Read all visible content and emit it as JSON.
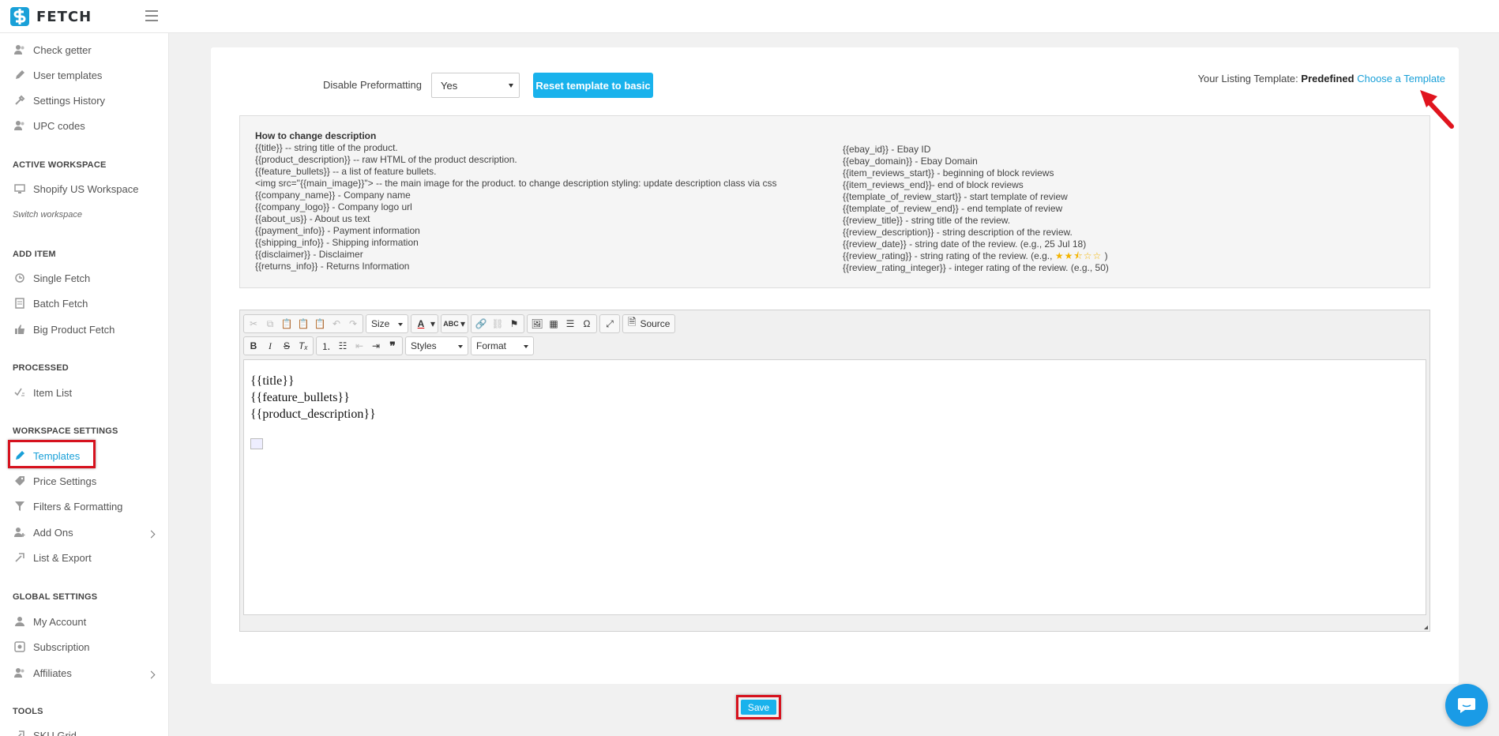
{
  "header": {
    "logo_text": "FETCH"
  },
  "sidebar": {
    "items_top": [
      {
        "label": "Check getter",
        "icon": "users-icon"
      },
      {
        "label": "User templates",
        "icon": "pencil-icon"
      },
      {
        "label": "Settings History",
        "icon": "tools-icon"
      },
      {
        "label": "UPC codes",
        "icon": "users-icon"
      }
    ],
    "active_workspace_heading": "ACTIVE WORKSPACE",
    "workspace": {
      "label": "Shopify US Workspace",
      "icon": "monitor-icon"
    },
    "switch_workspace": "Switch workspace",
    "add_item_heading": "ADD ITEM",
    "add_items": [
      {
        "label": "Single Fetch",
        "icon": "fetch-icon"
      },
      {
        "label": "Batch Fetch",
        "icon": "list-icon"
      },
      {
        "label": "Big Product Fetch",
        "icon": "thumb-icon"
      }
    ],
    "processed_heading": "PROCESSED",
    "processed_items": [
      {
        "label": "Item List",
        "icon": "check-list-icon"
      }
    ],
    "workspace_settings_heading": "WORKSPACE SETTINGS",
    "workspace_settings_items": [
      {
        "label": "Templates",
        "icon": "pencil-icon",
        "active": true
      },
      {
        "label": "Price Settings",
        "icon": "tag-icon"
      },
      {
        "label": "Filters & Formatting",
        "icon": "filter-icon"
      },
      {
        "label": "Add Ons",
        "icon": "user-plus-icon"
      },
      {
        "label": "List & Export",
        "icon": "export-icon"
      }
    ],
    "global_settings_heading": "GLOBAL SETTINGS",
    "global_settings_items": [
      {
        "label": "My Account",
        "icon": "user-icon"
      },
      {
        "label": "Subscription",
        "icon": "subscription-icon"
      },
      {
        "label": "Affiliates",
        "icon": "users-icon"
      }
    ],
    "tools_heading": "TOOLS",
    "tools_items": [
      {
        "label": "SKU Grid",
        "icon": "grid-icon"
      }
    ]
  },
  "settings": {
    "disable_preformatting_label": "Disable Preformatting",
    "disable_preformatting_value": "Yes",
    "reset_button": "Reset template to basic",
    "listing_template_label": "Your Listing Template:",
    "listing_template_value": "Predefined",
    "choose_template_link": "Choose a Template"
  },
  "help": {
    "heading": "How to change description",
    "left": [
      "{{title}} -- string title of the product.",
      "{{product_description}} -- raw HTML of the product description.",
      "{{feature_bullets}} -- a list of feature bullets.",
      "<img src=\"{{main_image}}\"> -- the main image for the product. to change description styling: update description class via css",
      "{{company_name}} - Company name",
      "{{company_logo}} - Company logo url",
      "{{about_us}} - About us text",
      "{{payment_info}} - Payment information",
      "{{shipping_info}} - Shipping information",
      "{{disclaimer}} - Disclaimer",
      "{{returns_info}} - Returns Information"
    ],
    "right": [
      "{{ebay_id}} - Ebay ID",
      "{{ebay_domain}} - Ebay Domain",
      "{{item_reviews_start}} - beginning of block reviews",
      "{{item_reviews_end}}- end of block reviews",
      "{{template_of_review_start}} - start template of review",
      "{{template_of_review_end}} - end template of review",
      "{{review_title}} - string title of the review.",
      "{{review_description}} - string description of the review.",
      "{{review_date}} - string date of the review. (e.g., 25 Jul 18)"
    ],
    "rating_line_prefix": "{{review_rating}} - string rating of the review. (e.g.,",
    "rating_stars": "★★⯪☆☆",
    "rating_line_suffix": ")",
    "rating_integer_line": "{{review_rating_integer}} - integer rating of the review. (e.g., 50)"
  },
  "editor": {
    "size_label": "Size",
    "source_label": "Source",
    "styles_label": "Styles",
    "format_label": "Format",
    "content_lines": [
      "{{title}}",
      "{{feature_bullets}}",
      "{{product_description}}"
    ]
  },
  "footer": {
    "save_label": "Save"
  },
  "colors": {
    "accent": "#19b2ec",
    "highlight": "#d6121e",
    "link": "#19a0d8"
  }
}
